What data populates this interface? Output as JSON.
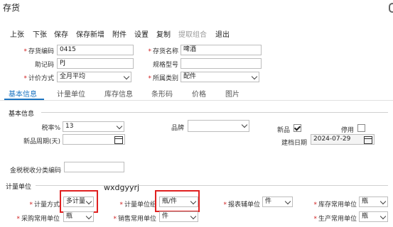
{
  "window": {
    "title": "存货"
  },
  "toolbar": {
    "prev": "上张",
    "next": "下张",
    "save": "保存",
    "save_new": "保存新增",
    "attach": "附件",
    "settings": "设置",
    "copy": "复制",
    "extract_combo": "提取组合",
    "exit": "退出"
  },
  "header_form": {
    "code_label": "存货编码",
    "code_value": "0415",
    "name_label": "存货名称",
    "name_value": "啤酒",
    "mnemonic_label": "助记码",
    "mnemonic_value": "PJ",
    "spec_label": "规格型号",
    "spec_value": "",
    "pricing_label": "计价方式",
    "pricing_value": "全月平均",
    "category_label": "所属类别",
    "category_value": "配件"
  },
  "tabs": [
    {
      "label": "基本信息",
      "active": true
    },
    {
      "label": "计量单位",
      "active": false
    },
    {
      "label": "库存信息",
      "active": false
    },
    {
      "label": "条形码",
      "active": false
    },
    {
      "label": "价格",
      "active": false
    },
    {
      "label": "图片",
      "active": false
    }
  ],
  "basic_info": {
    "section_title": "基本信息",
    "tax_rate_label": "税率%",
    "tax_rate_value": "13",
    "brand_label": "品牌",
    "brand_value": "",
    "new_cycle_label": "新品周期(天)",
    "new_cycle_value": "",
    "new_label": "新品",
    "new_checked": true,
    "disabled_label": "停用",
    "disabled_checked": false,
    "created_date_label": "建档日期",
    "created_date_value": "2024-07-29",
    "tax_class_label": "金税税收分类编码",
    "tax_class_value": ""
  },
  "units": {
    "section_title": "计量单位",
    "unit_mode_label": "计量方式",
    "unit_mode_value": "多计量",
    "unit_group_label": "计量单位组",
    "unit_group_value": "瓶/件",
    "report_unit_label": "报表辅单位",
    "report_unit_value": "件",
    "stock_unit_label": "库存常用单位",
    "stock_unit_value": "瓶",
    "purchase_unit_label": "采购常用单位",
    "purchase_unit_value": "瓶",
    "sales_unit_label": "销售常用单位",
    "sales_unit_value": "件",
    "production_unit_label": "生产常用单位",
    "production_unit_value": "瓶"
  },
  "overlay": {
    "watermark": "wxdgyyrj"
  },
  "colors": {
    "accent": "#1a73c0",
    "required": "#d02020",
    "highlight": "#e02020"
  }
}
